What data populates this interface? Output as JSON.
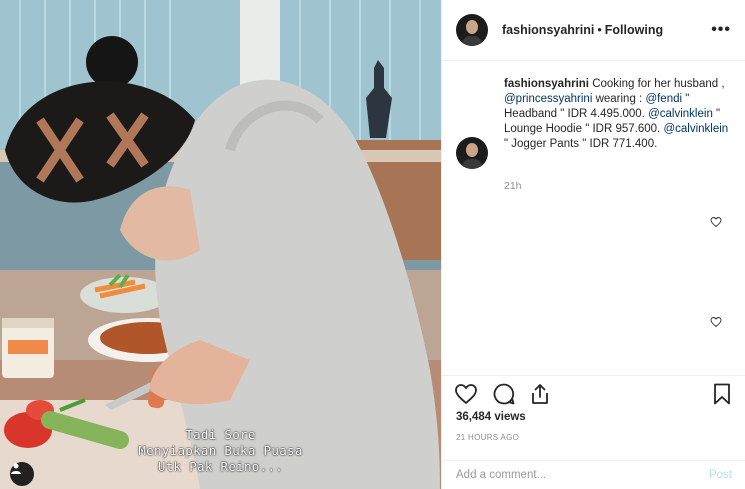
{
  "header": {
    "username": "fashionsyahrini",
    "separator": "•",
    "follow_status": "Following",
    "more_label": "•••"
  },
  "caption": {
    "username": "fashionsyahrini",
    "text_1": " Cooking for her husband , ",
    "mention_1": "@princessyahrini",
    "text_2": " wearing : ",
    "mention_2": "@fendi",
    "text_3": " \" Headband \" IDR 4.495.000. ",
    "mention_3": "@calvinklein",
    "text_4": " \" Lounge Hoodie \" IDR 957.600. ",
    "mention_4": "@calvinklein",
    "text_5": " \" Jogger Pants \" IDR 771.400.",
    "time": "21h"
  },
  "media": {
    "overlay_line_1": "Tadi Sore",
    "overlay_line_2": "Menyiapkan Buka Puasa",
    "overlay_line_3": "Utk Pak Reino..."
  },
  "actions": {
    "views": "36,484 views",
    "posted_ago": "21 HOURS AGO"
  },
  "add_comment": {
    "placeholder": "Add a comment...",
    "post_label": "Post"
  },
  "colors": {
    "link": "#003569",
    "post_disabled": "#b2dffc",
    "muted": "#8e8e8e"
  },
  "icons": [
    "heart-icon",
    "comment-icon",
    "share-icon",
    "bookmark-icon",
    "more-icon",
    "user-tag-icon"
  ]
}
